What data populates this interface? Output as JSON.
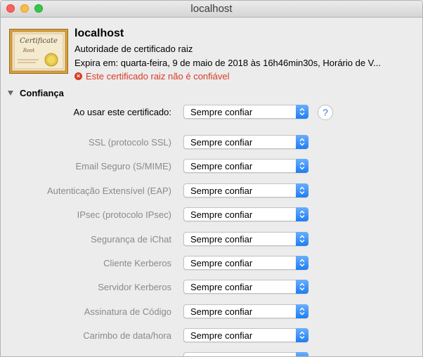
{
  "window": {
    "title": "localhost"
  },
  "certificate": {
    "name": "localhost",
    "authority": "Autoridade de certificado raiz",
    "expiry": "Expira em: quarta-feira, 9 de maio de 2018 às 16h46min30s, Horário de V...",
    "warning": "Este certificado raiz não é confiável",
    "icon_text_top": "Certificate",
    "icon_text_bottom": "Root"
  },
  "trust": {
    "section_label": "Confiança",
    "primary": {
      "label": "Ao usar este certificado:",
      "value": "Sempre confiar"
    },
    "help_label": "?",
    "rows": [
      {
        "label": "SSL (protocolo SSL)",
        "value": "Sempre confiar"
      },
      {
        "label": "Email Seguro (S/MIME)",
        "value": "Sempre confiar"
      },
      {
        "label": "Autenticação Extensível (EAP)",
        "value": "Sempre confiar"
      },
      {
        "label": "IPsec (protocolo IPsec)",
        "value": "Sempre confiar"
      },
      {
        "label": "Segurança de iChat",
        "value": "Sempre confiar"
      },
      {
        "label": "Cliente Kerberos",
        "value": "Sempre confiar"
      },
      {
        "label": "Servidor Kerberos",
        "value": "Sempre confiar"
      },
      {
        "label": "Assinatura de Código",
        "value": "Sempre confiar"
      },
      {
        "label": "Carimbo de data/hora",
        "value": "Sempre confiar"
      }
    ]
  },
  "colors": {
    "warning": "#d93b26",
    "accent": "#1e7df4"
  }
}
